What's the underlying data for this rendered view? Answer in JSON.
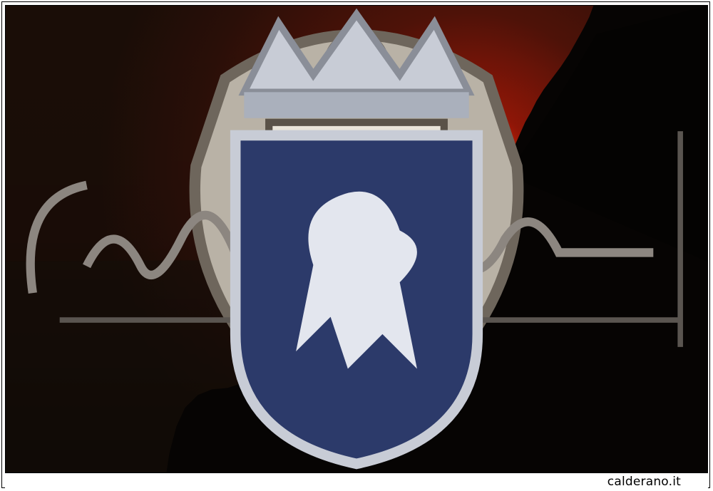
{
  "photo": {
    "subject": "sunset-over-cliff",
    "colors": {
      "sky_dark": "#1e0e08",
      "sky_red": "#6e1408",
      "sun_core": "#fff9b0",
      "sun_rim": "#ffb300",
      "cliff": "#070504"
    }
  },
  "watermarks": {
    "top_crest": "coat-of-arms-icon",
    "signature": "signature-icon",
    "bottom_crest": "crowned-lion-crest-icon"
  },
  "caption": {
    "site": "calderano.it"
  }
}
